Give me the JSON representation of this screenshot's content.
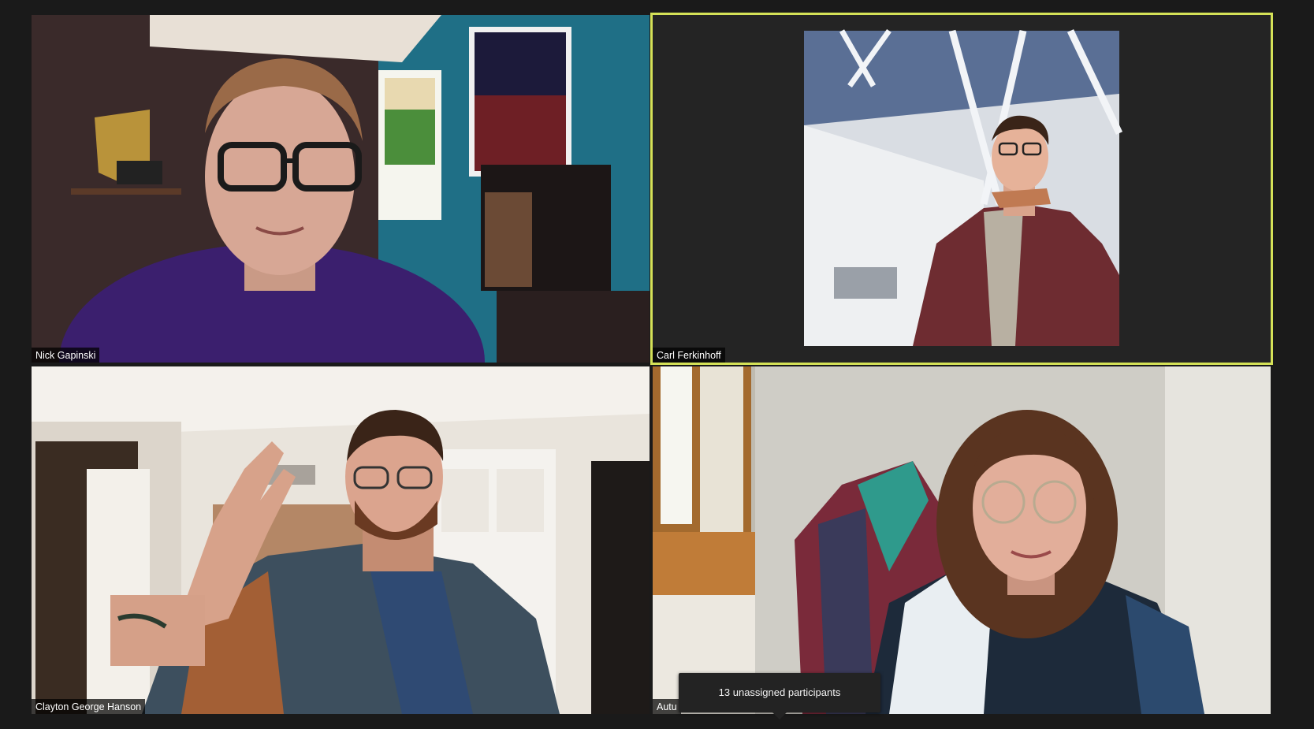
{
  "meeting": {
    "background_color": "#1a1a1a",
    "active_speaker_color": "#d4e157"
  },
  "participants": [
    {
      "name": "Nick Gapinski",
      "is_active_speaker": false
    },
    {
      "name": "Carl Ferkinhoff",
      "is_active_speaker": true
    },
    {
      "name": "Clayton George Hanson",
      "is_active_speaker": false
    },
    {
      "name": "Autu",
      "is_active_speaker": false
    }
  ],
  "breakout": {
    "tooltip_text": "13 unassigned participants"
  },
  "icons": [
    "tooltip-arrow-icon"
  ]
}
